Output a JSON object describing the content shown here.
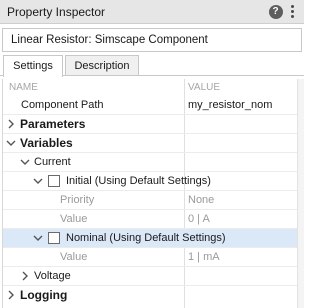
{
  "window": {
    "title": "Property Inspector"
  },
  "header": {
    "text": "Linear Resistor: Simscape Component"
  },
  "tabs": [
    {
      "label": "Settings"
    },
    {
      "label": "Description"
    }
  ],
  "grid": {
    "columns": {
      "name": "NAME",
      "value": "VALUE"
    },
    "component_path": {
      "label": "Component Path",
      "value": "my_resistor_nom"
    },
    "parameters": {
      "label": "Parameters"
    },
    "variables": {
      "label": "Variables"
    },
    "current": {
      "label": "Current"
    },
    "initial": {
      "label": "Initial (Using Default Settings)"
    },
    "priority": {
      "label": "Priority",
      "value": "None"
    },
    "initial_value": {
      "label": "Value",
      "value": "0  |  A"
    },
    "nominal": {
      "label": "Nominal (Using Default Settings)"
    },
    "nominal_value": {
      "label": "Value",
      "value": "1  |  mA"
    },
    "voltage": {
      "label": "Voltage"
    },
    "logging": {
      "label": "Logging"
    }
  }
}
